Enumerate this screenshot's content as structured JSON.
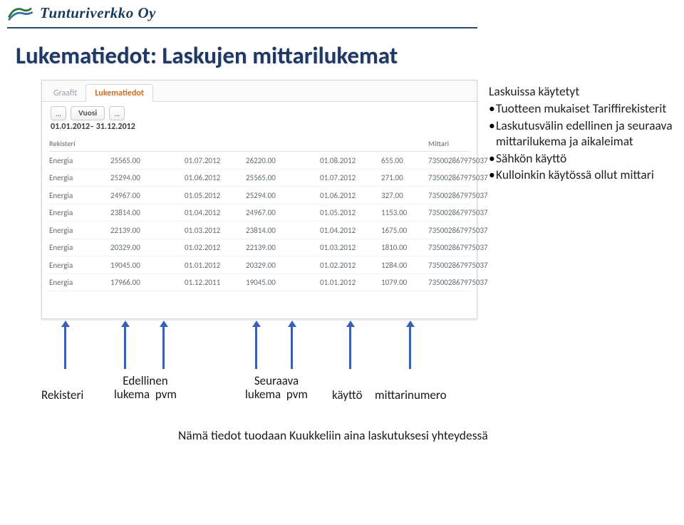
{
  "brand": "Tunturiverkko Oy",
  "title": "Lukematiedot: Laskujen mittarilukemat",
  "tabs": {
    "graafit": "Graafit",
    "lukematiedot": "Lukematiedot"
  },
  "yearbar": {
    "prev": "...",
    "year": "Vuosi",
    "next": "..."
  },
  "range": "01.01.2012– 31.12.2012",
  "headers": {
    "rekisteri": "Rekisteri",
    "mittari": "Mittari"
  },
  "rows": [
    {
      "reg": "Energia",
      "v1": "25565.00",
      "d1": "01.07.2012",
      "v2": "26220.00",
      "d2": "01.08.2012",
      "qty": "655.00",
      "meter": "735002867975037"
    },
    {
      "reg": "Energia",
      "v1": "25294.00",
      "d1": "01.06.2012",
      "v2": "25565.00",
      "d2": "01.07.2012",
      "qty": "271.00",
      "meter": "735002867975037"
    },
    {
      "reg": "Energia",
      "v1": "24967.00",
      "d1": "01.05.2012",
      "v2": "25294.00",
      "d2": "01.06.2012",
      "qty": "327.00",
      "meter": "735002867975037"
    },
    {
      "reg": "Energia",
      "v1": "23814.00",
      "d1": "01.04.2012",
      "v2": "24967.00",
      "d2": "01.05.2012",
      "qty": "1153.00",
      "meter": "735002867975037"
    },
    {
      "reg": "Energia",
      "v1": "22139.00",
      "d1": "01.03.2012",
      "v2": "23814.00",
      "d2": "01.04.2012",
      "qty": "1675.00",
      "meter": "735002867975037"
    },
    {
      "reg": "Energia",
      "v1": "20329.00",
      "d1": "01.02.2012",
      "v2": "22139.00",
      "d2": "01.03.2012",
      "qty": "1810.00",
      "meter": "735002867975037"
    },
    {
      "reg": "Energia",
      "v1": "19045.00",
      "d1": "01.01.2012",
      "v2": "20329.00",
      "d2": "01.02.2012",
      "qty": "1284.00",
      "meter": "735002867975037"
    },
    {
      "reg": "Energia",
      "v1": "17966.00",
      "d1": "01.12.2011",
      "v2": "19045.00",
      "d2": "01.01.2012",
      "qty": "1079.00",
      "meter": "735002867975037"
    }
  ],
  "notes": {
    "intro": "Laskuissa käytetyt",
    "b1": "Tuotteen mukaiset Tariffirekisterit",
    "b2": "Laskutusvälin edellinen ja seuraava mittarilukema ja aikaleimat",
    "b3": "Sähkön käyttö",
    "b4": "Kulloinkin käytössä ollut mittari"
  },
  "labels": {
    "rekisteri": "Rekisteri",
    "edellinen_top": "Edellinen",
    "seuraava_top": "Seuraava",
    "lukema": "lukema",
    "pvm": "pvm",
    "kaytto": "käyttö",
    "mittarinumero": "mittarinumero"
  },
  "bottom": "Nämä tiedot tuodaan Kuukkeliin aina laskutuksesi yhteydessä"
}
